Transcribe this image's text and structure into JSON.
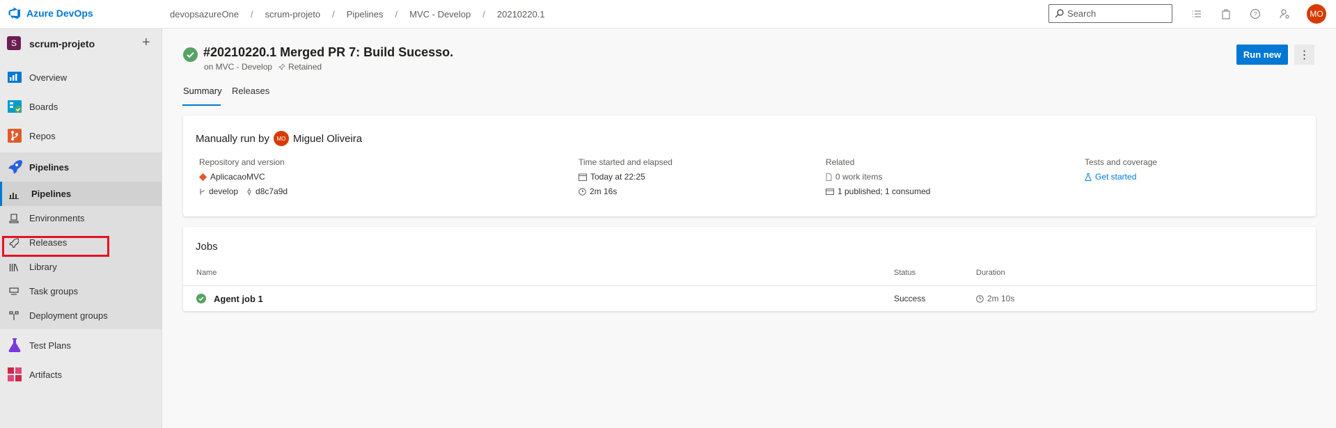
{
  "app": {
    "name": "Azure DevOps"
  },
  "breadcrumb": [
    "devopsazureOne",
    "scrum-projeto",
    "Pipelines",
    "MVC - Develop",
    "20210220.1"
  ],
  "search": {
    "placeholder": "Search"
  },
  "user": {
    "initials": "MO"
  },
  "sidebar": {
    "project": {
      "letter": "S",
      "name": "scrum-projeto"
    },
    "items": [
      {
        "label": "Overview",
        "icon": "overview-icon"
      },
      {
        "label": "Boards",
        "icon": "boards-icon"
      },
      {
        "label": "Repos",
        "icon": "repos-icon"
      },
      {
        "label": "Pipelines",
        "icon": "pipelines-icon"
      },
      {
        "label": "Pipelines",
        "icon": "pipelines-sub-icon"
      },
      {
        "label": "Environments",
        "icon": "environments-icon"
      },
      {
        "label": "Releases",
        "icon": "releases-icon"
      },
      {
        "label": "Library",
        "icon": "library-icon"
      },
      {
        "label": "Task groups",
        "icon": "task-groups-icon"
      },
      {
        "label": "Deployment groups",
        "icon": "deployment-groups-icon"
      },
      {
        "label": "Test Plans",
        "icon": "test-plans-icon"
      },
      {
        "label": "Artifacts",
        "icon": "artifacts-icon"
      }
    ]
  },
  "run": {
    "title": "#20210220.1 Merged PR 7: Build Sucesso.",
    "pipeline": "on MVC - Develop",
    "retained": "Retained",
    "run_button": "Run new",
    "status_color": "#55a362"
  },
  "tabs": [
    "Summary",
    "Releases"
  ],
  "summary": {
    "manually_run_by": "Manually run by",
    "user_initials": "MO",
    "user_name": "Miguel Oliveira",
    "repo": {
      "header": "Repository and version",
      "name": "AplicacaoMVC",
      "branch": "develop",
      "commit": "d8c7a9d"
    },
    "time": {
      "header": "Time started and elapsed",
      "started": "Today at 22:25",
      "elapsed": "2m 16s"
    },
    "related": {
      "header": "Related",
      "work_items": "0 work items",
      "artifacts": "1 published; 1 consumed"
    },
    "tests": {
      "header": "Tests and coverage",
      "link": "Get started"
    }
  },
  "jobs": {
    "title": "Jobs",
    "columns": [
      "Name",
      "Status",
      "Duration"
    ],
    "rows": [
      {
        "name": "Agent job 1",
        "status": "Success",
        "duration": "2m 10s"
      }
    ]
  }
}
